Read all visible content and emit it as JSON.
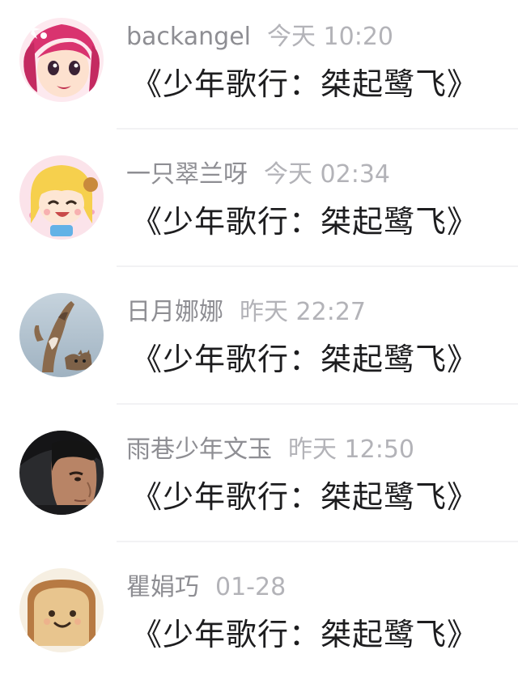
{
  "messages": [
    {
      "user": "backangel",
      "time": "今天 10:20",
      "title": "《少年歌行：桀起鹭飞》",
      "avatar_icon": "cartoon-girl-pink-hair-avatar"
    },
    {
      "user": "一只翠兰呀",
      "time": "今天 02:34",
      "title": "《少年歌行：桀起鹭飞》",
      "avatar_icon": "anime-blonde-girl-avatar"
    },
    {
      "user": "日月娜娜",
      "time": "昨天 22:27",
      "title": "《少年歌行：桀起鹭飞》",
      "avatar_icon": "stretching-cat-avatar"
    },
    {
      "user": "雨巷少年文玉",
      "time": "昨天 12:50",
      "title": "《少年歌行：桀起鹭飞》",
      "avatar_icon": "young-man-photo-avatar"
    },
    {
      "user": "瞿娟巧",
      "time": "01-28",
      "title": "《少年歌行：桀起鹭飞》",
      "avatar_icon": "smiling-toast-avatar"
    }
  ]
}
